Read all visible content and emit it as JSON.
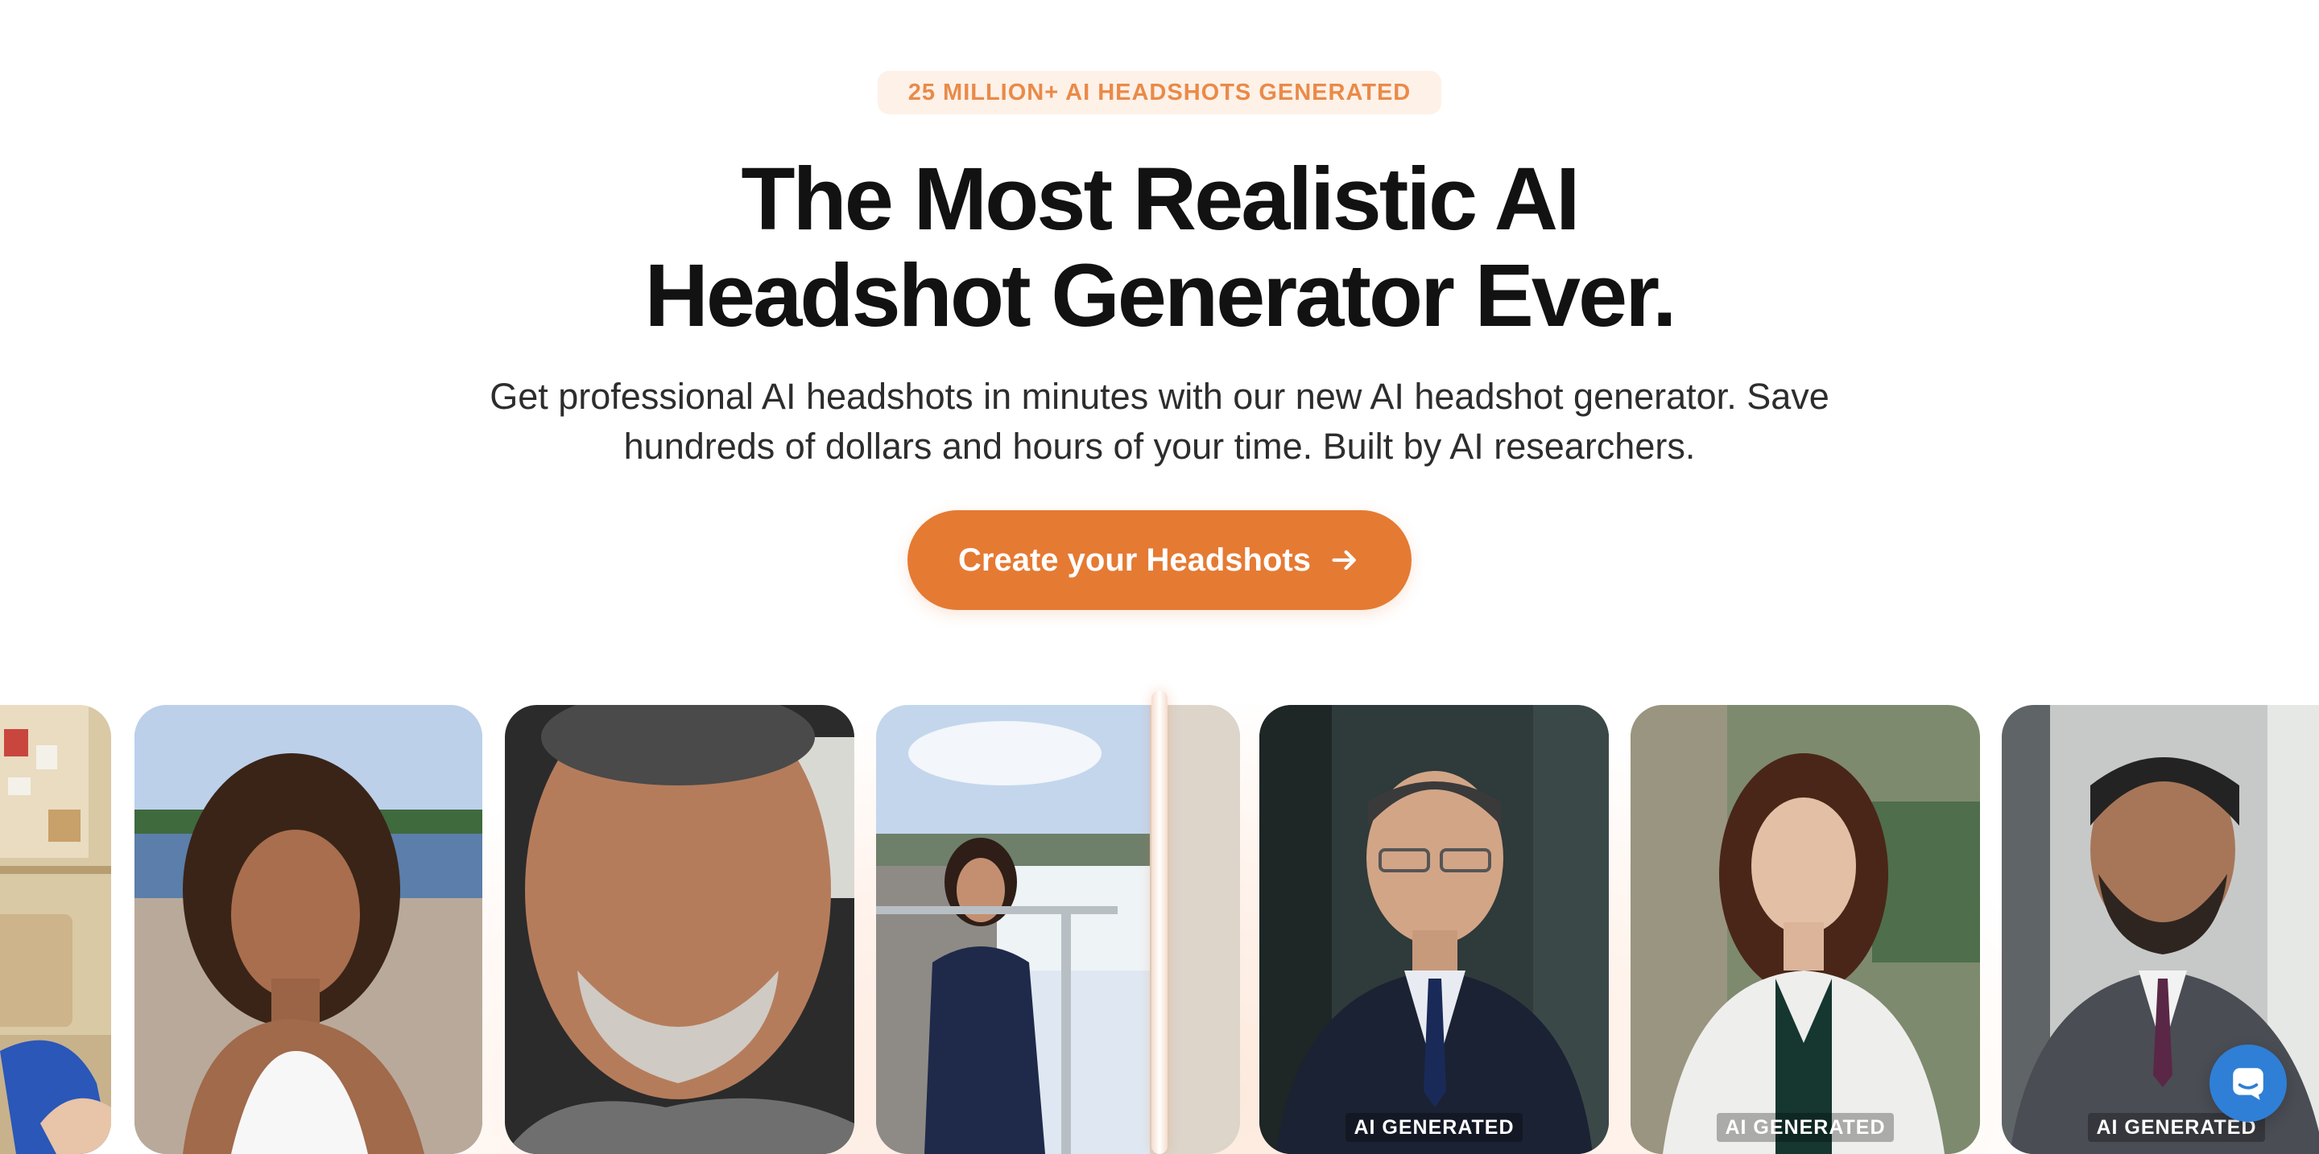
{
  "hero": {
    "badge": "25 MILLION+ AI HEADSHOTS GENERATED",
    "title_line1": "The Most Realistic AI",
    "title_line2": "Headshot Generator Ever.",
    "subtitle_line1": "Get professional AI headshots in minutes with our new AI headshot generator. Save",
    "subtitle_line2": "hundreds of dollars and hours of your time. Built by AI researchers.",
    "cta_label": "Create your Headshots",
    "cta_icon": "arrow-right-icon"
  },
  "gallery": {
    "before_photos": [
      {
        "name": "selfie-office-partial"
      },
      {
        "name": "selfie-woman-lake"
      },
      {
        "name": "selfie-man-car"
      },
      {
        "name": "photo-woman-waterfall"
      }
    ],
    "ai_photos": [
      {
        "name": "ai-headshot-man-glasses-suit",
        "label": "AI GENERATED"
      },
      {
        "name": "ai-headshot-woman-white-blazer",
        "label": "AI GENERATED"
      },
      {
        "name": "ai-headshot-man-beard-suit",
        "label": "AI GENERATED"
      }
    ]
  },
  "chat": {
    "icon": "chat-widget-icon"
  },
  "colors": {
    "accent": "#e57a33",
    "badge_text": "#ea8a48",
    "badge_bg": "#fdf1e8",
    "title": "#121212",
    "chat": "#2f7fd6"
  }
}
